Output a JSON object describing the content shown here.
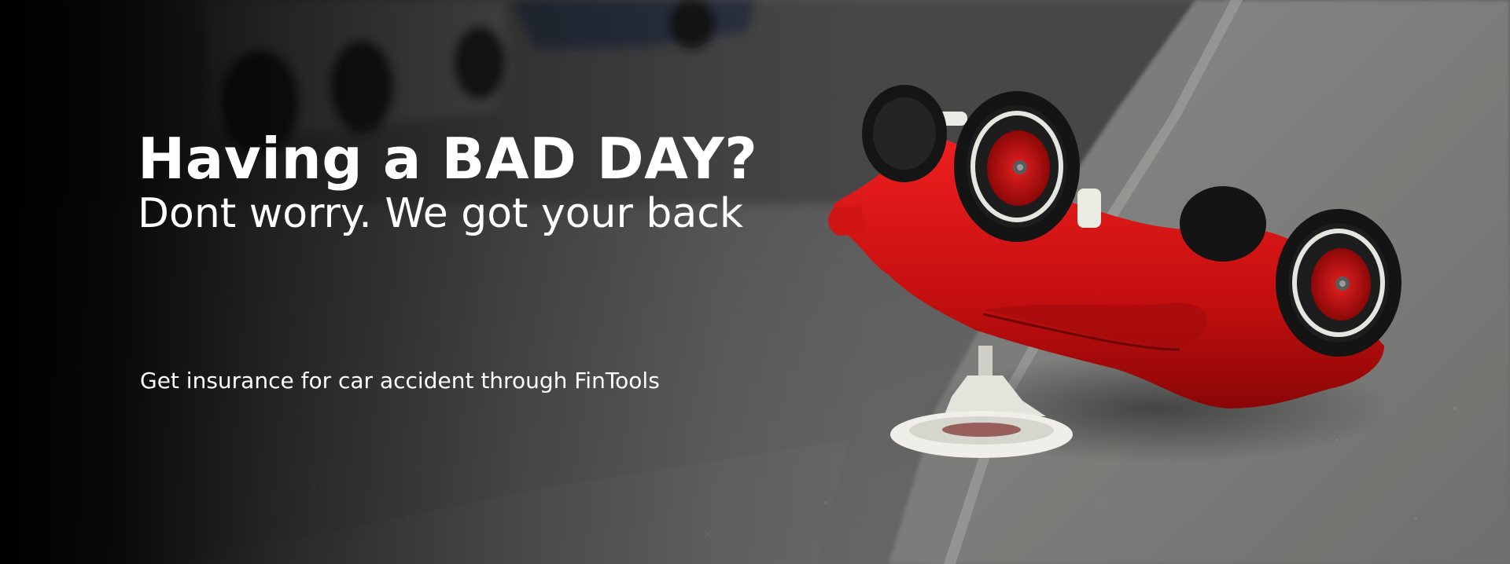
{
  "hero": {
    "title": "Having a BAD DAY?",
    "subtitle": "Dont worry. We got your back",
    "tagline": "Get insurance for car accident through FinTools"
  },
  "image": {
    "subject": "overturned-red-toy-car-on-street"
  }
}
